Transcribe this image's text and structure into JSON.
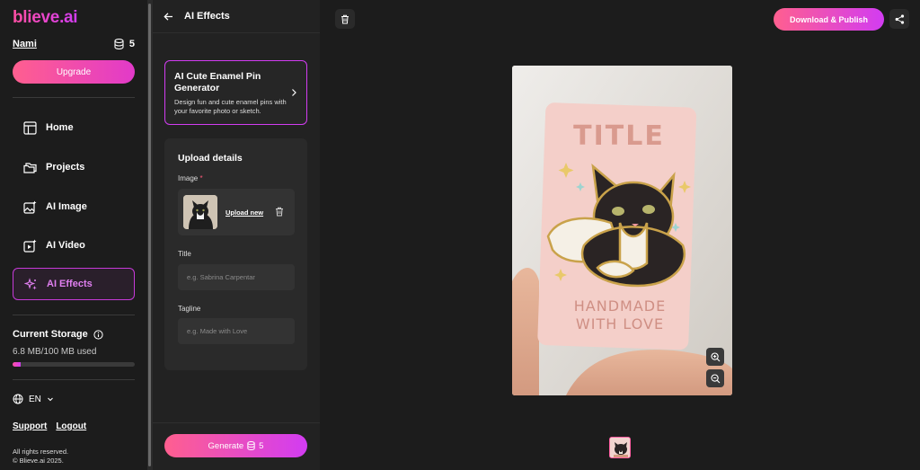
{
  "app": {
    "logo": "blieve.ai"
  },
  "user": {
    "name": "Nami",
    "credits": "5"
  },
  "sidebar": {
    "upgrade_label": "Upgrade",
    "items": [
      {
        "label": "Home",
        "icon": "layout-icon"
      },
      {
        "label": "Projects",
        "icon": "folders-icon"
      },
      {
        "label": "AI Image",
        "icon": "image-sparkle-icon"
      },
      {
        "label": "AI Video",
        "icon": "video-sparkle-icon"
      },
      {
        "label": "AI Effects",
        "icon": "sparkles-icon",
        "active": true
      }
    ],
    "storage_title": "Current Storage",
    "storage_used": "6.8 MB/100 MB used",
    "storage_fraction": 0.068,
    "language": "EN",
    "support_label": "Support",
    "logout_label": "Logout",
    "copyright_line1": "All rights reserved.",
    "copyright_line2": "© Blieve.ai 2025."
  },
  "panel": {
    "title": "AI Effects",
    "effect": {
      "title": "AI Cute Enamel Pin Generator",
      "description": "Design fun and cute enamel pins with your favorite photo or sketch."
    },
    "upload": {
      "title": "Upload details",
      "image_label": "Image",
      "required_mark": "*",
      "upload_new_label": "Upload new",
      "title_label": "Title",
      "title_placeholder": "e.g. Sabrina Carpentar",
      "tagline_label": "Tagline",
      "tagline_placeholder": "e.g. Made with Love"
    },
    "generate_label": "Generate",
    "generate_cost": "5"
  },
  "canvas": {
    "download_label": "Download & Publish",
    "card_title": "TITLE",
    "card_tagline_line1": "HANDMADE",
    "card_tagline_line2": "WITH LOVE"
  },
  "colors": {
    "accent_pink": "#ff5f8f",
    "accent_purple": "#d23cf2",
    "background": "#1c1c1c"
  }
}
